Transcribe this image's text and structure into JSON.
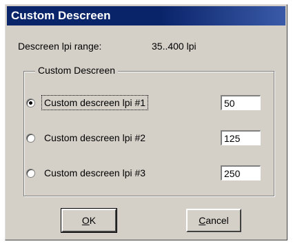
{
  "window": {
    "title": "Custom Descreen"
  },
  "range": {
    "label": "Descreen lpi range:",
    "value": "35..400 lpi"
  },
  "group": {
    "title": "Custom Descreen",
    "options": [
      {
        "label": "Custom descreen lpi #1",
        "value": "50",
        "selected": true
      },
      {
        "label": "Custom descreen lpi #2",
        "value": "125",
        "selected": false
      },
      {
        "label": "Custom descreen lpi #3",
        "value": "250",
        "selected": false
      }
    ]
  },
  "buttons": {
    "ok": {
      "mnemonic": "O",
      "rest": "K"
    },
    "cancel": {
      "mnemonic": "C",
      "rest": "ancel"
    }
  }
}
